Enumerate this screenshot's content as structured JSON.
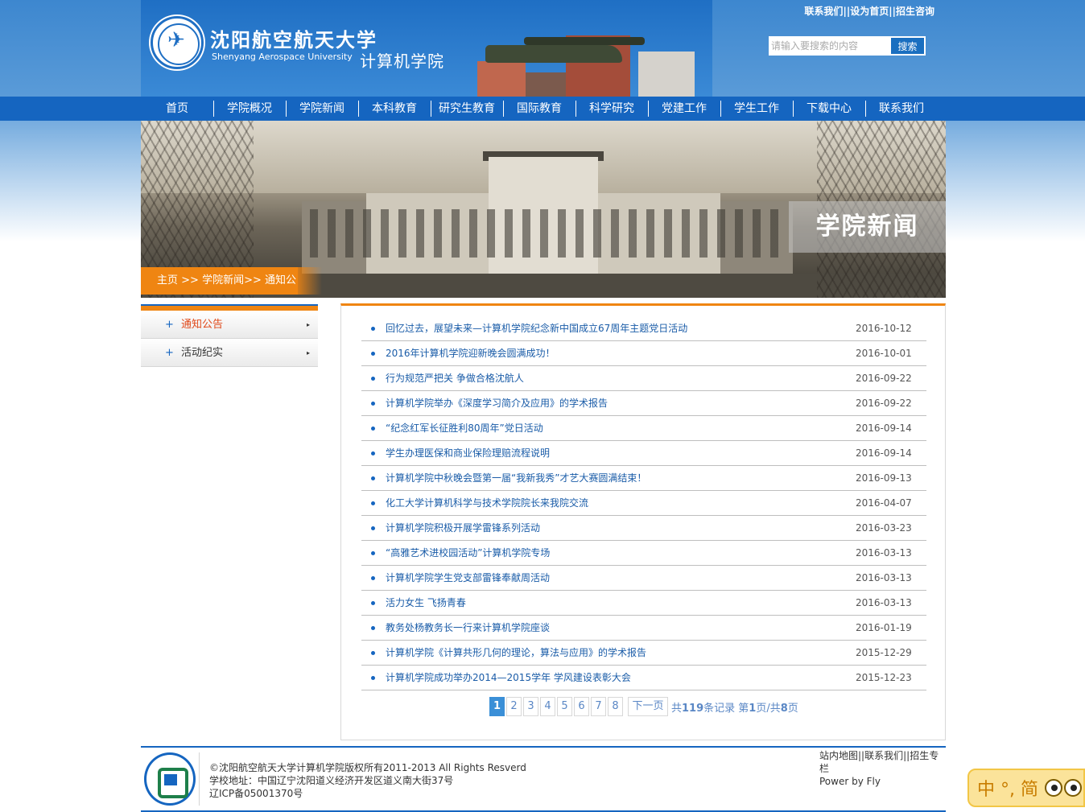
{
  "header": {
    "school_cn": "沈阳航空航天大学",
    "school_en": "Shenyang Aerospace University",
    "college_name": "计算机学院",
    "top_links": [
      "联系我们",
      "设为首页",
      "招生咨询"
    ],
    "search": {
      "placeholder": "请输入要搜索的内容",
      "button_label": "搜索"
    }
  },
  "nav": [
    "首页",
    "学院概况",
    "学院新闻",
    "本科教育",
    "研究生教育",
    "国际教育",
    "科学研究",
    "党建工作",
    "学生工作",
    "下载中心",
    "联系我们"
  ],
  "banner": {
    "caption": "学院新闻",
    "breadcrumb": [
      "主页",
      ">>",
      "学院新闻",
      ">>",
      "通知公告"
    ]
  },
  "sidebar": {
    "items": [
      {
        "icon": "+",
        "label": "通知公告",
        "arrow": "▸",
        "active": true
      },
      {
        "icon": "+",
        "label": "活动纪实",
        "arrow": "▸",
        "active": false
      }
    ]
  },
  "news": [
    {
      "title": "回忆过去，展望未来—计算机学院纪念新中国成立67周年主题党日活动",
      "date": "2016-10-12"
    },
    {
      "title": "2016年计算机学院迎新晚会圆满成功！",
      "date": "2016-10-01"
    },
    {
      "title": "行为规范严把关 争做合格沈航人",
      "date": "2016-09-22"
    },
    {
      "title": "计算机学院举办《深度学习简介及应用》的学术报告",
      "date": "2016-09-22"
    },
    {
      "title": "“纪念红军长征胜利80周年”党日活动",
      "date": "2016-09-14"
    },
    {
      "title": "学生办理医保和商业保险理赔流程说明",
      "date": "2016-09-14"
    },
    {
      "title": "计算机学院中秋晚会暨第一届“我新我秀”才艺大赛圆满结束！",
      "date": "2016-09-13"
    },
    {
      "title": "化工大学计算机科学与技术学院院长来我院交流",
      "date": "2016-04-07"
    },
    {
      "title": "计算机学院积极开展学雷锋系列活动",
      "date": "2016-03-23"
    },
    {
      "title": "“高雅艺术进校园活动”计算机学院专场",
      "date": "2016-03-13"
    },
    {
      "title": "计算机学院学生党支部雷锋奉献周活动",
      "date": "2016-03-13"
    },
    {
      "title": "活力女生 飞扬青春",
      "date": "2016-03-13"
    },
    {
      "title": "教务处杨教务长一行来计算机学院座谈",
      "date": "2016-01-19"
    },
    {
      "title": "计算机学院《计算共形几何的理论，算法与应用》的学术报告",
      "date": "2015-12-29"
    },
    {
      "title": "计算机学院成功举办2014—2015学年 学风建设表彰大会",
      "date": "2015-12-23"
    }
  ],
  "pager": {
    "pages": [
      "1",
      "2",
      "3",
      "4",
      "5",
      "6",
      "7",
      "8"
    ],
    "current": "1",
    "next_label": "下一页",
    "info_prefix": "共",
    "total_records": "119",
    "info_records": "条记录 第",
    "current_page": "1",
    "info_mid": "页/共",
    "total_pages": "8",
    "info_suffix": "页"
  },
  "footer": {
    "copyright": "©沈阳航空航天大学计算机学院版权所有2011-2013 All Rights Resverd",
    "address": "学校地址：中国辽宁沈阳道义经济开发区道义南大街37号",
    "icp": "辽ICP备05001370号",
    "links": [
      "站内地图",
      "联系我们",
      "招生专栏"
    ],
    "powered": "Power by Fly"
  },
  "ime": {
    "text": "中 °, 简"
  },
  "colors": {
    "nav_blue": "#1565c0",
    "accent_orange": "#ef8512",
    "link_blue": "#1a5ca8"
  }
}
